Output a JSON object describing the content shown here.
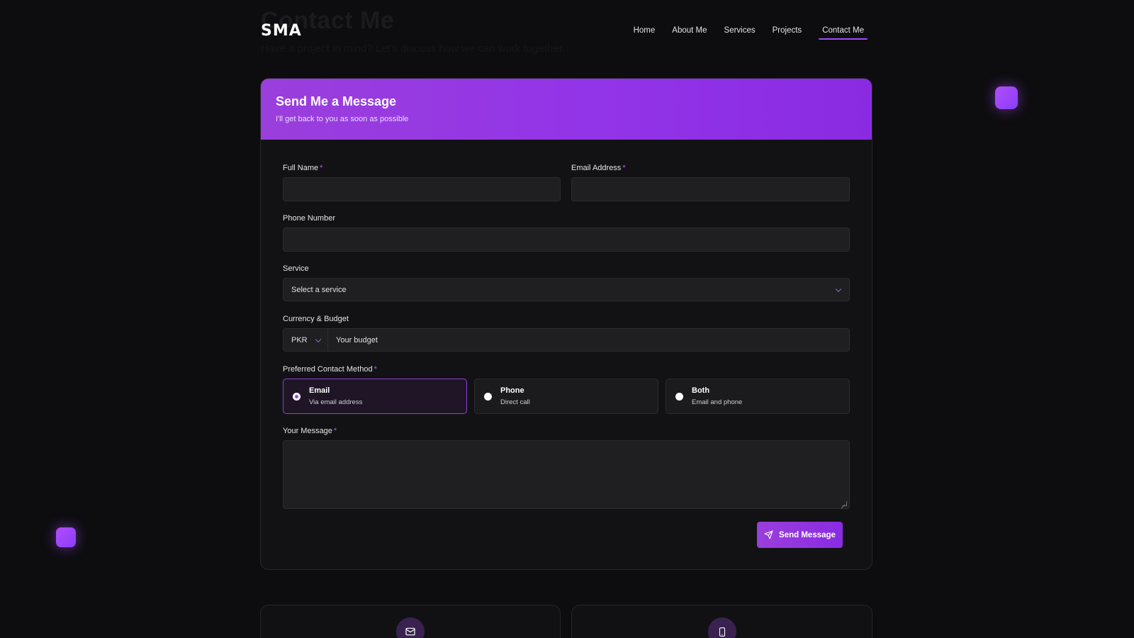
{
  "ghost": {
    "title": "Contact Me",
    "subtitle": "Have a project in mind? Let's discuss how we can work together."
  },
  "header": {
    "logo": "SMA",
    "nav": [
      "Home",
      "About Me",
      "Services",
      "Projects",
      "Contact Me"
    ],
    "active_nav": "Contact Me"
  },
  "form": {
    "title": "Send Me a Message",
    "subtitle": "I'll get back to you as soon as possible",
    "full_name_label": "Full Name",
    "email_label": "Email Address",
    "phone_label": "Phone Number",
    "service_label": "Service",
    "service_placeholder": "Select a service",
    "budget_label": "Currency & Budget",
    "currency_value": "PKR",
    "budget_placeholder": "Your budget",
    "contact_method_label": "Preferred Contact Method",
    "contact_methods": [
      {
        "title": "Email",
        "desc": "Via email address",
        "selected": true
      },
      {
        "title": "Phone",
        "desc": "Direct call",
        "selected": false
      },
      {
        "title": "Both",
        "desc": "Email and phone",
        "selected": false
      }
    ],
    "message_label": "Your Message",
    "required_mark": "*",
    "submit_label": "Send Message"
  },
  "colors": {
    "accent": "#9234e8",
    "background": "#0d0d0f",
    "card": "#121214"
  },
  "icons": {
    "info_left": "mail-icon",
    "info_right": "phone-icon",
    "submit": "send-icon"
  }
}
